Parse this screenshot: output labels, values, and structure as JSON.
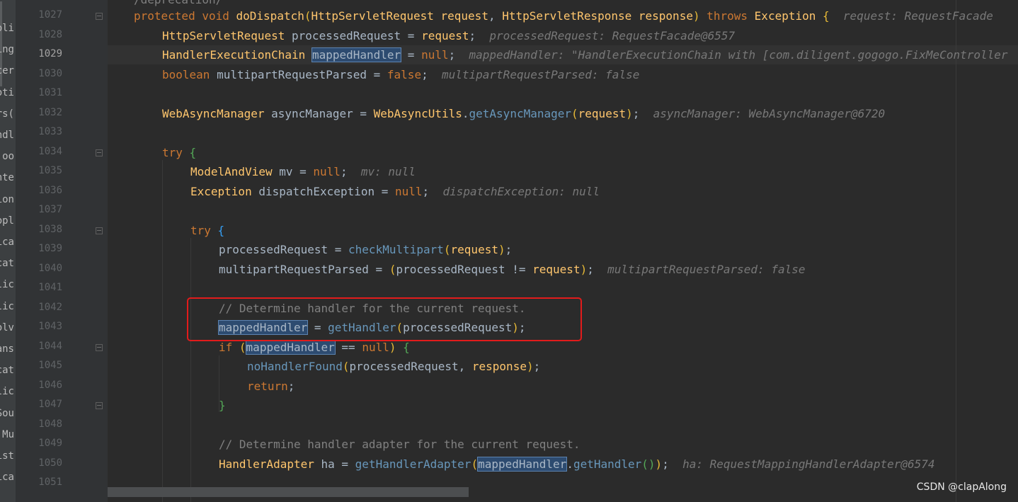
{
  "left_strip": [
    "oli",
    "ing",
    "cer",
    "oti",
    "rs(",
    "ndl",
    "oo",
    "nte",
    "ion",
    "opl",
    "ica",
    "cat",
    "lic",
    "lic",
    "olv",
    "ans",
    "cat",
    "lic",
    "Sou",
    " Mu",
    "ist",
    "ica"
  ],
  "top_cut_text": "/deprecation/",
  "line_numbers": [
    "1027",
    "1028",
    "1029",
    "1030",
    "1031",
    "1032",
    "1033",
    "1034",
    "1035",
    "1036",
    "1037",
    "1038",
    "1039",
    "1040",
    "1041",
    "1042",
    "1043",
    "1044",
    "1045",
    "1046",
    "1047",
    "1048",
    "1049",
    "1050",
    "1051"
  ],
  "code": {
    "l1027": {
      "protected": "protected",
      "void": "void",
      "method": "doDispatch",
      "t1": "HttpServletRequest",
      "p1": "request",
      "t2": "HttpServletResponse",
      "p2": "response",
      "throws": "throws",
      "exc": "Exception",
      "brace": "{",
      "hint": "request: RequestFacade"
    },
    "l1028": {
      "type": "HttpServletRequest",
      "var": "processedRequest",
      "value": "request",
      "hint": "processedRequest: RequestFacade@6557"
    },
    "l1029": {
      "type": "HandlerExecutionChain",
      "var": "mappedHandler",
      "value": "null",
      "hint": "mappedHandler: \"HandlerExecutionChain with [com.diligent.gogogo.FixMeController"
    },
    "l1030": {
      "type": "boolean",
      "var": "multipartRequestParsed",
      "value": "false",
      "hint": "multipartRequestParsed: false"
    },
    "l1032": {
      "type": "WebAsyncManager",
      "var": "asyncManager",
      "cls": "WebAsyncUtils",
      "call": "getAsyncManager",
      "arg": "request",
      "hint": "asyncManager: WebAsyncManager@6720"
    },
    "l1034": {
      "kw": "try",
      "brace": "{"
    },
    "l1035": {
      "type": "ModelAndView",
      "var": "mv",
      "value": "null",
      "hint": "mv: null"
    },
    "l1036": {
      "type": "Exception",
      "var": "dispatchException",
      "value": "null",
      "hint": "dispatchException: null"
    },
    "l1038": {
      "kw": "try",
      "brace": "{"
    },
    "l1039": {
      "var": "processedRequest",
      "call": "checkMultipart",
      "arg": "request"
    },
    "l1040": {
      "var": "multipartRequestParsed",
      "a": "processedRequest",
      "op": "!=",
      "b": "request",
      "hint": "multipartRequestParsed: false"
    },
    "l1042": {
      "comment": "// Determine handler for the current request."
    },
    "l1043": {
      "var": "mappedHandler",
      "call": "getHandler",
      "arg": "processedRequest"
    },
    "l1044": {
      "kw": "if",
      "var": "mappedHandler",
      "op": "==",
      "value": "null",
      "brace": "{"
    },
    "l1045": {
      "call": "noHandlerFound",
      "a": "processedRequest",
      "b": "response"
    },
    "l1046": {
      "kw": "return"
    },
    "l1047": {
      "brace": "}"
    },
    "l1049": {
      "comment": "// Determine handler adapter for the current request."
    },
    "l1050": {
      "type": "HandlerAdapter",
      "var": "ha",
      "call": "getHandlerAdapter",
      "arg": "mappedHandler",
      "call2": "getHandler",
      "hint": "ha: RequestMappingHandlerAdapter@6574"
    }
  },
  "watermark": "CSDN @clapAlong"
}
